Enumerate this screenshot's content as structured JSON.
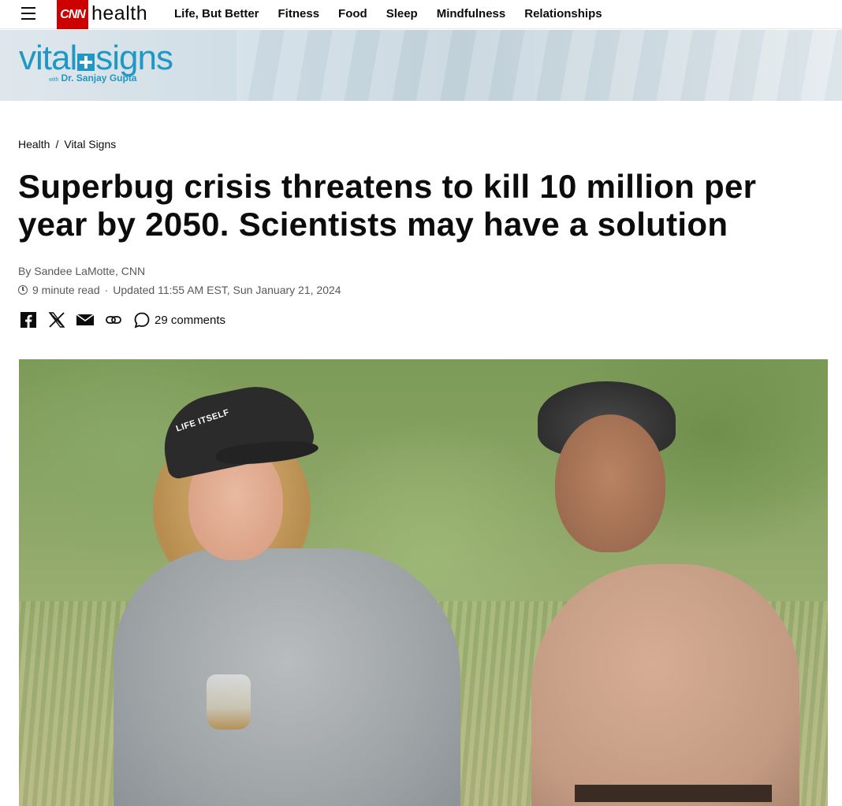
{
  "topnav": {
    "brand": "CNN",
    "section": "health",
    "links": [
      "Life, But Better",
      "Fitness",
      "Food",
      "Sleep",
      "Mindfulness",
      "Relationships"
    ]
  },
  "banner": {
    "logo_word_left": "vital",
    "logo_word_right": "signs",
    "logo_with": "with",
    "logo_sub": "Dr. Sanjay Gupta"
  },
  "breadcrumb": {
    "items": [
      "Health",
      "Vital Signs"
    ],
    "separator": "/"
  },
  "article": {
    "headline": "Superbug crisis threatens to kill 10 million per year by 2050. Scientists may have a solution",
    "byline": "By Sandee LaMotte, CNN",
    "read_time": "9 minute read",
    "dot": "·",
    "updated": "Updated 11:55 AM EST, Sun January 21, 2024",
    "comments": "29 comments"
  },
  "hero": {
    "cap_text": "LIFE ITSELF"
  },
  "colors": {
    "cnn_red": "#cc0000",
    "vital_blue": "#1f98c5",
    "text": "#0c0c0c",
    "meta": "#595959"
  },
  "icons": [
    "menu-icon",
    "facebook-icon",
    "x-icon",
    "email-icon",
    "link-icon",
    "comment-icon",
    "clock-icon",
    "plus-cross-icon"
  ]
}
